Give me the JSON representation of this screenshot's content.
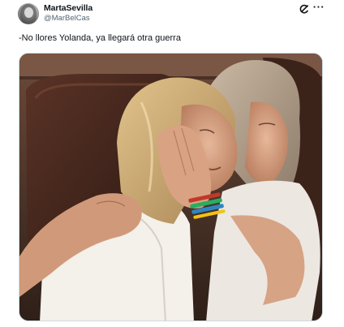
{
  "author": {
    "display_name": "MartaSevilla",
    "handle": "@MarBelCas"
  },
  "tweet": {
    "text": "-No llores Yolanda, ya llegará otra guerra"
  },
  "icons": {
    "grok": "grok-icon",
    "more": "more-options-icon",
    "more_glyph": "···"
  },
  "colors": {
    "text": "#0f1419",
    "secondary_text": "#536471",
    "border": "#cfd9de"
  }
}
